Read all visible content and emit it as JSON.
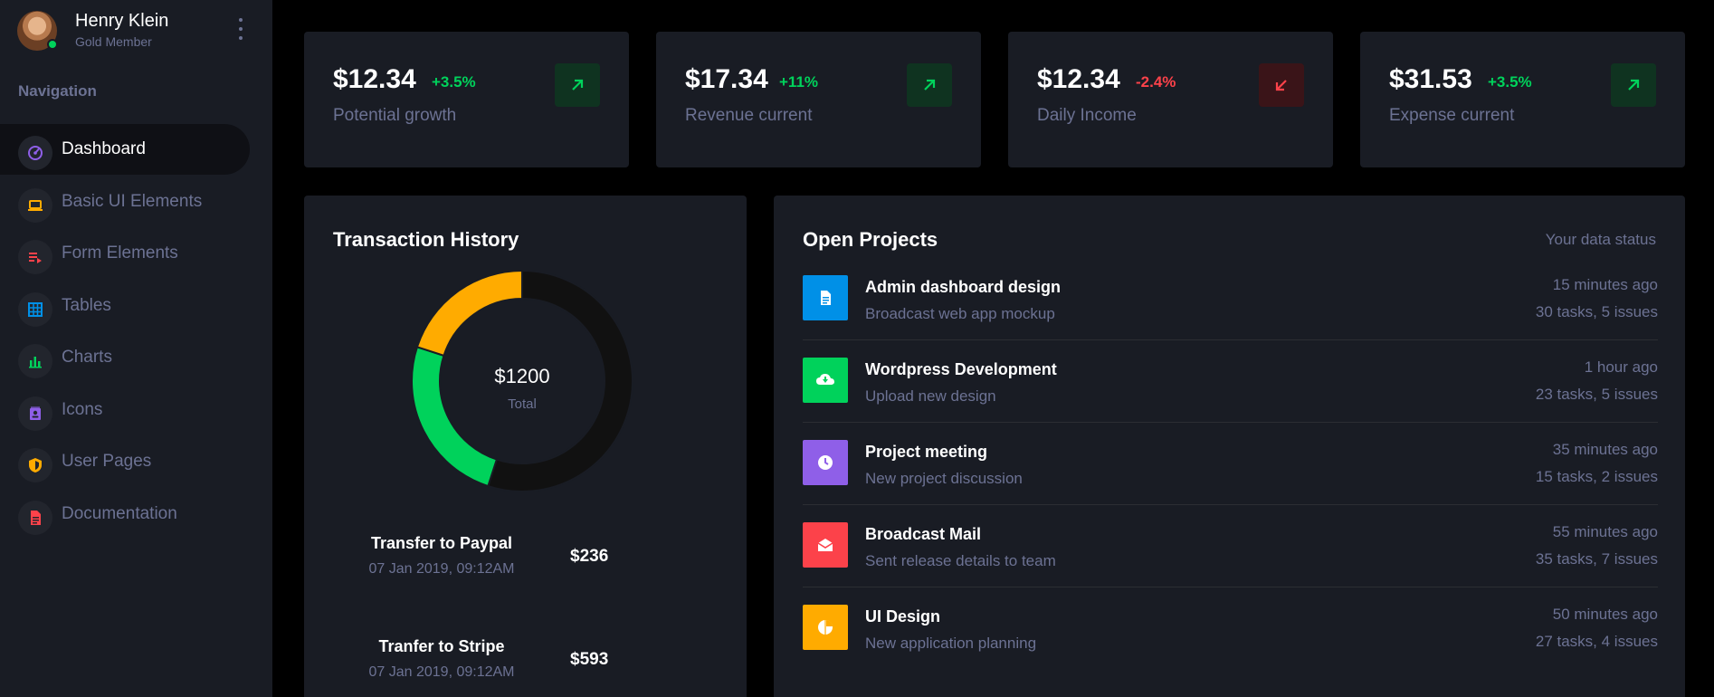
{
  "profile": {
    "name": "Henry Klein",
    "level": "Gold Member"
  },
  "sidebar": {
    "heading": "Navigation",
    "items": [
      {
        "label": "Dashboard",
        "icon": "speedometer-icon",
        "color": "#8f5fe8",
        "active": true
      },
      {
        "label": "Basic UI Elements",
        "icon": "laptop-icon",
        "color": "#ffab00"
      },
      {
        "label": "Form Elements",
        "icon": "playlist-play-icon",
        "color": "#fc424a"
      },
      {
        "label": "Tables",
        "icon": "table-large-icon",
        "color": "#0090e7"
      },
      {
        "label": "Charts",
        "icon": "chart-bar-icon",
        "color": "#00d25b"
      },
      {
        "label": "Icons",
        "icon": "contacts-icon",
        "color": "#8f5fe8"
      },
      {
        "label": "User Pages",
        "icon": "security-icon",
        "color": "#ffab00"
      },
      {
        "label": "Documentation",
        "icon": "file-document-icon",
        "color": "#fc424a"
      }
    ]
  },
  "stats": [
    {
      "value": "$12.34",
      "delta": "+3.5%",
      "label": "Potential growth",
      "trend": "up"
    },
    {
      "value": "$17.34",
      "delta": "+11%",
      "label": "Revenue current",
      "trend": "up"
    },
    {
      "value": "$12.34",
      "delta": "-2.4%",
      "label": "Daily Income",
      "trend": "down"
    },
    {
      "value": "$31.53",
      "delta": "+3.5%",
      "label": "Expense current",
      "trend": "up"
    }
  ],
  "colors": {
    "success": "#00d25b",
    "danger": "#fc424a",
    "warning": "#ffab00",
    "primary": "#0090e7",
    "purple": "#8f5fe8",
    "donut_track": "#111111"
  },
  "transaction_history": {
    "title": "Transaction History",
    "total_value": "$1200",
    "total_label": "Total",
    "chart_data": {
      "type": "pie",
      "segments": [
        {
          "value": 55,
          "color": "#111111"
        },
        {
          "value": 25,
          "color": "#00d25b"
        },
        {
          "value": 20,
          "color": "#ffab00"
        }
      ]
    },
    "transactions": [
      {
        "title": "Transfer to Paypal",
        "date": "07 Jan 2019, 09:12AM",
        "amount": "$236"
      },
      {
        "title": "Tranfer to Stripe",
        "date": "07 Jan 2019, 09:12AM",
        "amount": "$593"
      }
    ]
  },
  "open_projects": {
    "title": "Open Projects",
    "subtitle": "Your data status",
    "projects": [
      {
        "title": "Admin dashboard design",
        "desc": "Broadcast web app mockup",
        "time": "15 minutes ago",
        "tasks": "30 tasks, 5 issues",
        "icon": "file-document-icon",
        "color": "#0090e7"
      },
      {
        "title": "Wordpress Development",
        "desc": "Upload new design",
        "time": "1 hour ago",
        "tasks": "23 tasks, 5 issues",
        "icon": "cloud-download-icon",
        "color": "#00d25b"
      },
      {
        "title": "Project meeting",
        "desc": "New project discussion",
        "time": "35 minutes ago",
        "tasks": "15 tasks, 2 issues",
        "icon": "clock-icon",
        "color": "#8f5fe8"
      },
      {
        "title": "Broadcast Mail",
        "desc": "Sent release details to team",
        "time": "55 minutes ago",
        "tasks": "35 tasks, 7 issues",
        "icon": "email-open-icon",
        "color": "#fc424a"
      },
      {
        "title": "UI Design",
        "desc": "New application planning",
        "time": "50 minutes ago",
        "tasks": "27 tasks, 4 issues",
        "icon": "chart-pie-icon",
        "color": "#ffab00"
      }
    ]
  }
}
